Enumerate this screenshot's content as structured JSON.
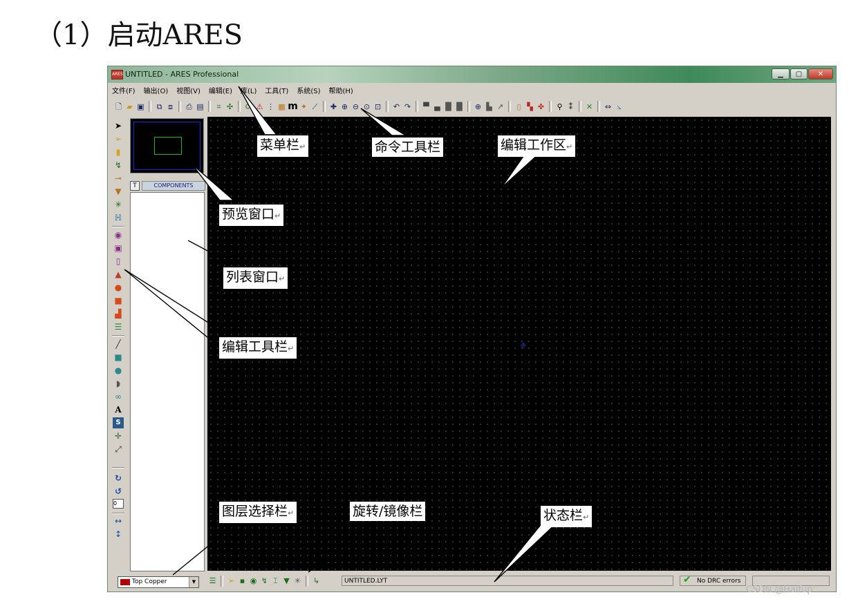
{
  "heading": "（1）启动ARES",
  "window": {
    "title": "UNTITLED - ARES Professional",
    "app_icon_text": "ARES",
    "btn_min": "▁",
    "btn_max": "▢",
    "btn_close": "✕"
  },
  "menu": {
    "items": [
      "文件(F)",
      "输出(O)",
      "视图(V)",
      "编辑(E)",
      "库(L)",
      "工具(T)",
      "系统(S)",
      "帮助(H)"
    ]
  },
  "toolbar": {
    "icons": [
      "new-file-icon",
      "open-folder-icon",
      "save-icon",
      "import-icon",
      "export-icon",
      "print-icon",
      "print-setup-icon",
      "netlist-icon",
      "autoroute-icon",
      "refresh-icon",
      "flip-icon",
      "grid-icon",
      "layers-icon",
      "metric-icon",
      "origin-icon",
      "real-time-snap-icon",
      "pan-icon",
      "zoom-in-icon",
      "zoom-out-icon",
      "zoom-all-icon",
      "zoom-area-icon",
      "undo-icon",
      "redo-icon",
      "block-copy-icon",
      "block-move-icon",
      "block-rotate-icon",
      "block-delete-icon",
      "pick-icon",
      "make-package-icon",
      "decompose-icon",
      "design-explorer-icon",
      "package-tool-icon",
      "place-icon",
      "search-icon",
      "tag-icon",
      "drc-icon",
      "resize-icon",
      "gerber-icon"
    ],
    "m_label": "m"
  },
  "left_tools": {
    "icons": [
      "select-arrow-icon",
      "component-icon",
      "package-icon",
      "track-icon",
      "via-icon",
      "zone-icon",
      "ratsnest-icon",
      "connectivity-icon",
      "round-pad-icon",
      "square-pad-icon",
      "dil-pad-icon",
      "edge-pad-icon",
      "circle-smt-icon",
      "rect-smt-icon",
      "polygon-pad-icon",
      "padstack-icon",
      "line-icon",
      "box-icon",
      "circle-icon",
      "arc-icon",
      "path-icon",
      "text-icon",
      "symbol-icon",
      "marker-icon",
      "dimension-icon",
      "rotate-cw-icon",
      "rotate-ccw-icon",
      "mirror-x-icon",
      "mirror-y-icon"
    ],
    "text_glyph": "A",
    "symbol_glyph": "S",
    "angle_value": "0"
  },
  "components_panel": {
    "t_button": "T",
    "tab_label": "COMPONENTS"
  },
  "status": {
    "layer": "Top Copper",
    "layer_color": "#b30000",
    "file": "UNTITLED.LYT",
    "drc": "No DRC errors"
  },
  "labels": {
    "menubar": "菜单栏",
    "command_toolbar": "命令工具栏",
    "edit_area": "编辑工作区",
    "preview": "预览窗口",
    "list": "列表窗口",
    "edit_toolbar": "编辑工具栏",
    "layer_select": "图层选择栏",
    "rotate_mirror": "旋转/镜像栏",
    "statusbar": "状态栏",
    "return_mark": "↵"
  },
  "watermark": "CSDN @Halfup'"
}
